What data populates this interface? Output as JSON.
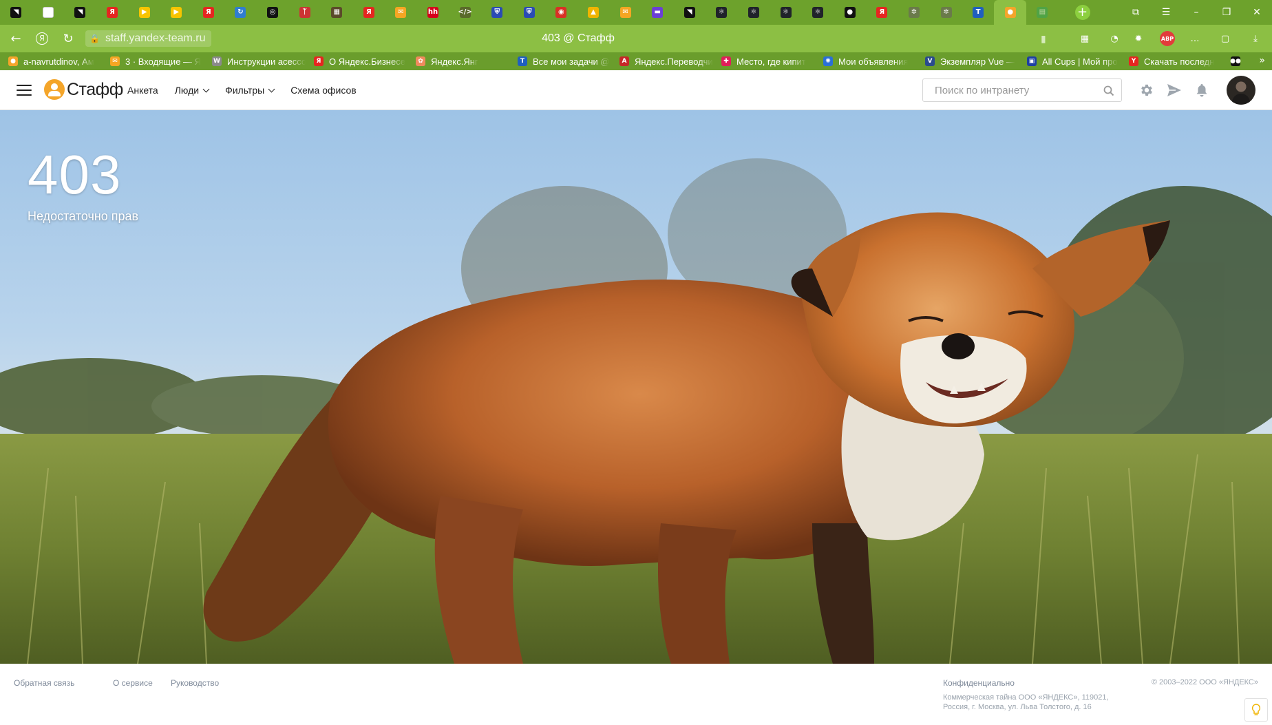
{
  "browser": {
    "url": "staff.yandex-team.ru",
    "page_title": "403 @ Стафф",
    "tabs": [
      {
        "icon": "black-square-icon",
        "color": "#111111",
        "glyph": "◥"
      },
      {
        "icon": "page-icon",
        "color": "#ffffff",
        "glyph": ""
      },
      {
        "icon": "black-square-icon",
        "color": "#111111",
        "glyph": "◥"
      },
      {
        "icon": "yandex-icon",
        "color": "#e52620",
        "glyph": "Я"
      },
      {
        "icon": "play-icon",
        "color": "#f7c400",
        "glyph": "▶"
      },
      {
        "icon": "play-icon",
        "color": "#f7c400",
        "glyph": "▶"
      },
      {
        "icon": "yandex-icon",
        "color": "#e52620",
        "glyph": "Я"
      },
      {
        "icon": "circle-arrow-icon",
        "color": "#2f7dd1",
        "glyph": "↻"
      },
      {
        "icon": "target-icon",
        "color": "#111111",
        "glyph": "◎"
      },
      {
        "icon": "figure-icon",
        "color": "#cc3333",
        "glyph": "ᛉ"
      },
      {
        "icon": "board-icon",
        "color": "#5b4a2a",
        "glyph": "▦"
      },
      {
        "icon": "yandex-icon",
        "color": "#e52620",
        "glyph": "Я"
      },
      {
        "icon": "mail-icon",
        "color": "#f5a623",
        "glyph": "✉"
      },
      {
        "icon": "hh-icon",
        "color": "#d6001c",
        "glyph": "hh"
      },
      {
        "icon": "code-icon",
        "color": "#5a6a2a",
        "glyph": "</>"
      },
      {
        "icon": "shield-icon",
        "color": "#2a4bb5",
        "glyph": "⛨"
      },
      {
        "icon": "shield-icon",
        "color": "#2a4bb5",
        "glyph": "⛨"
      },
      {
        "icon": "chrome-icon",
        "color": "#d93025",
        "glyph": "◉"
      },
      {
        "icon": "image-icon",
        "color": "#f0b400",
        "glyph": "▲"
      },
      {
        "icon": "mail-icon",
        "color": "#f5a623",
        "glyph": "✉"
      },
      {
        "icon": "messenger-icon",
        "color": "#6b3fd6",
        "glyph": "▬"
      },
      {
        "icon": "black-square-icon",
        "color": "#111111",
        "glyph": "◥"
      },
      {
        "icon": "react-icon",
        "color": "#20232a",
        "glyph": "⚛"
      },
      {
        "icon": "react-icon",
        "color": "#20232a",
        "glyph": "⚛"
      },
      {
        "icon": "react-icon",
        "color": "#20232a",
        "glyph": "⚛"
      },
      {
        "icon": "react-icon",
        "color": "#20232a",
        "glyph": "⚛"
      },
      {
        "icon": "github-icon",
        "color": "#111111",
        "glyph": "●"
      },
      {
        "icon": "yandex-icon",
        "color": "#e52620",
        "glyph": "Я"
      },
      {
        "icon": "gear-icon",
        "color": "#6a7a4a",
        "glyph": "✲"
      },
      {
        "icon": "gear-icon",
        "color": "#6a7a4a",
        "glyph": "✲"
      },
      {
        "icon": "tracker-icon",
        "color": "#1f5fbf",
        "glyph": "T"
      },
      {
        "icon": "staff-icon",
        "color": "#f4a52a",
        "glyph": "●",
        "active": true
      },
      {
        "icon": "doc-icon",
        "color": "#3aa55a",
        "glyph": "▤",
        "pale": true
      }
    ],
    "bookmarks": [
      {
        "label": "a-navrutdinov, Ам",
        "color": "#f4a52a",
        "glyph": "●"
      },
      {
        "label": "3 · Входящие — Я",
        "color": "#f5a623",
        "glyph": "✉"
      },
      {
        "label": "Инструкции асессора",
        "color": "#8a8a8a",
        "glyph": "W"
      },
      {
        "label": "О Яндекс.Бизнесе",
        "color": "#e52620",
        "glyph": "Я"
      },
      {
        "label": "Яндекс.Янг",
        "color": "#f08a5d",
        "glyph": "✿"
      },
      {
        "label": "Все мои задачи @",
        "color": "#1f5fbf",
        "glyph": "T"
      },
      {
        "label": "Яндекс.Переводчик",
        "color": "#c62828",
        "glyph": "A"
      },
      {
        "label": "Место, где кипит",
        "color": "#e01e5a",
        "glyph": "✚"
      },
      {
        "label": "Мои объявления",
        "color": "#2b6fd6",
        "glyph": "✺"
      },
      {
        "label": "Экземпляр Vue —",
        "color": "#2a4b8d",
        "glyph": "V"
      },
      {
        "label": "All Cups | Мой про",
        "color": "#1d3fa3",
        "glyph": "▣"
      },
      {
        "label": "Скачать последн",
        "color": "#e52620",
        "glyph": "Y"
      },
      {
        "label": "",
        "color": "#111111",
        "glyph": "●●"
      }
    ]
  },
  "header": {
    "logo_text": "Стафф",
    "nav": [
      {
        "label": "Анкета",
        "dropdown": false
      },
      {
        "label": "Люди",
        "dropdown": true
      },
      {
        "label": "Фильтры",
        "dropdown": true
      },
      {
        "label": "Схема офисов",
        "dropdown": false
      }
    ],
    "search_placeholder": "Поиск по интранету"
  },
  "error": {
    "code": "403",
    "message": "Недостаточно прав"
  },
  "footer": {
    "links": [
      "Обратная связь",
      "О сервисе",
      "Руководство"
    ],
    "confidential": "Конфиденциально",
    "address_line1": "Коммерческая тайна ООО «ЯНДЕКС», 119021,",
    "address_line2": "Россия, г. Москва, ул. Льва Толстого, д. 16",
    "copyright": "© 2003–2022  ООО «ЯНДЕКС»"
  },
  "colors": {
    "chrome_dark": "#6da22c",
    "chrome_light": "#8cbf44",
    "logo_orange": "#f4a52a",
    "footer_text": "#7f8a9a"
  }
}
